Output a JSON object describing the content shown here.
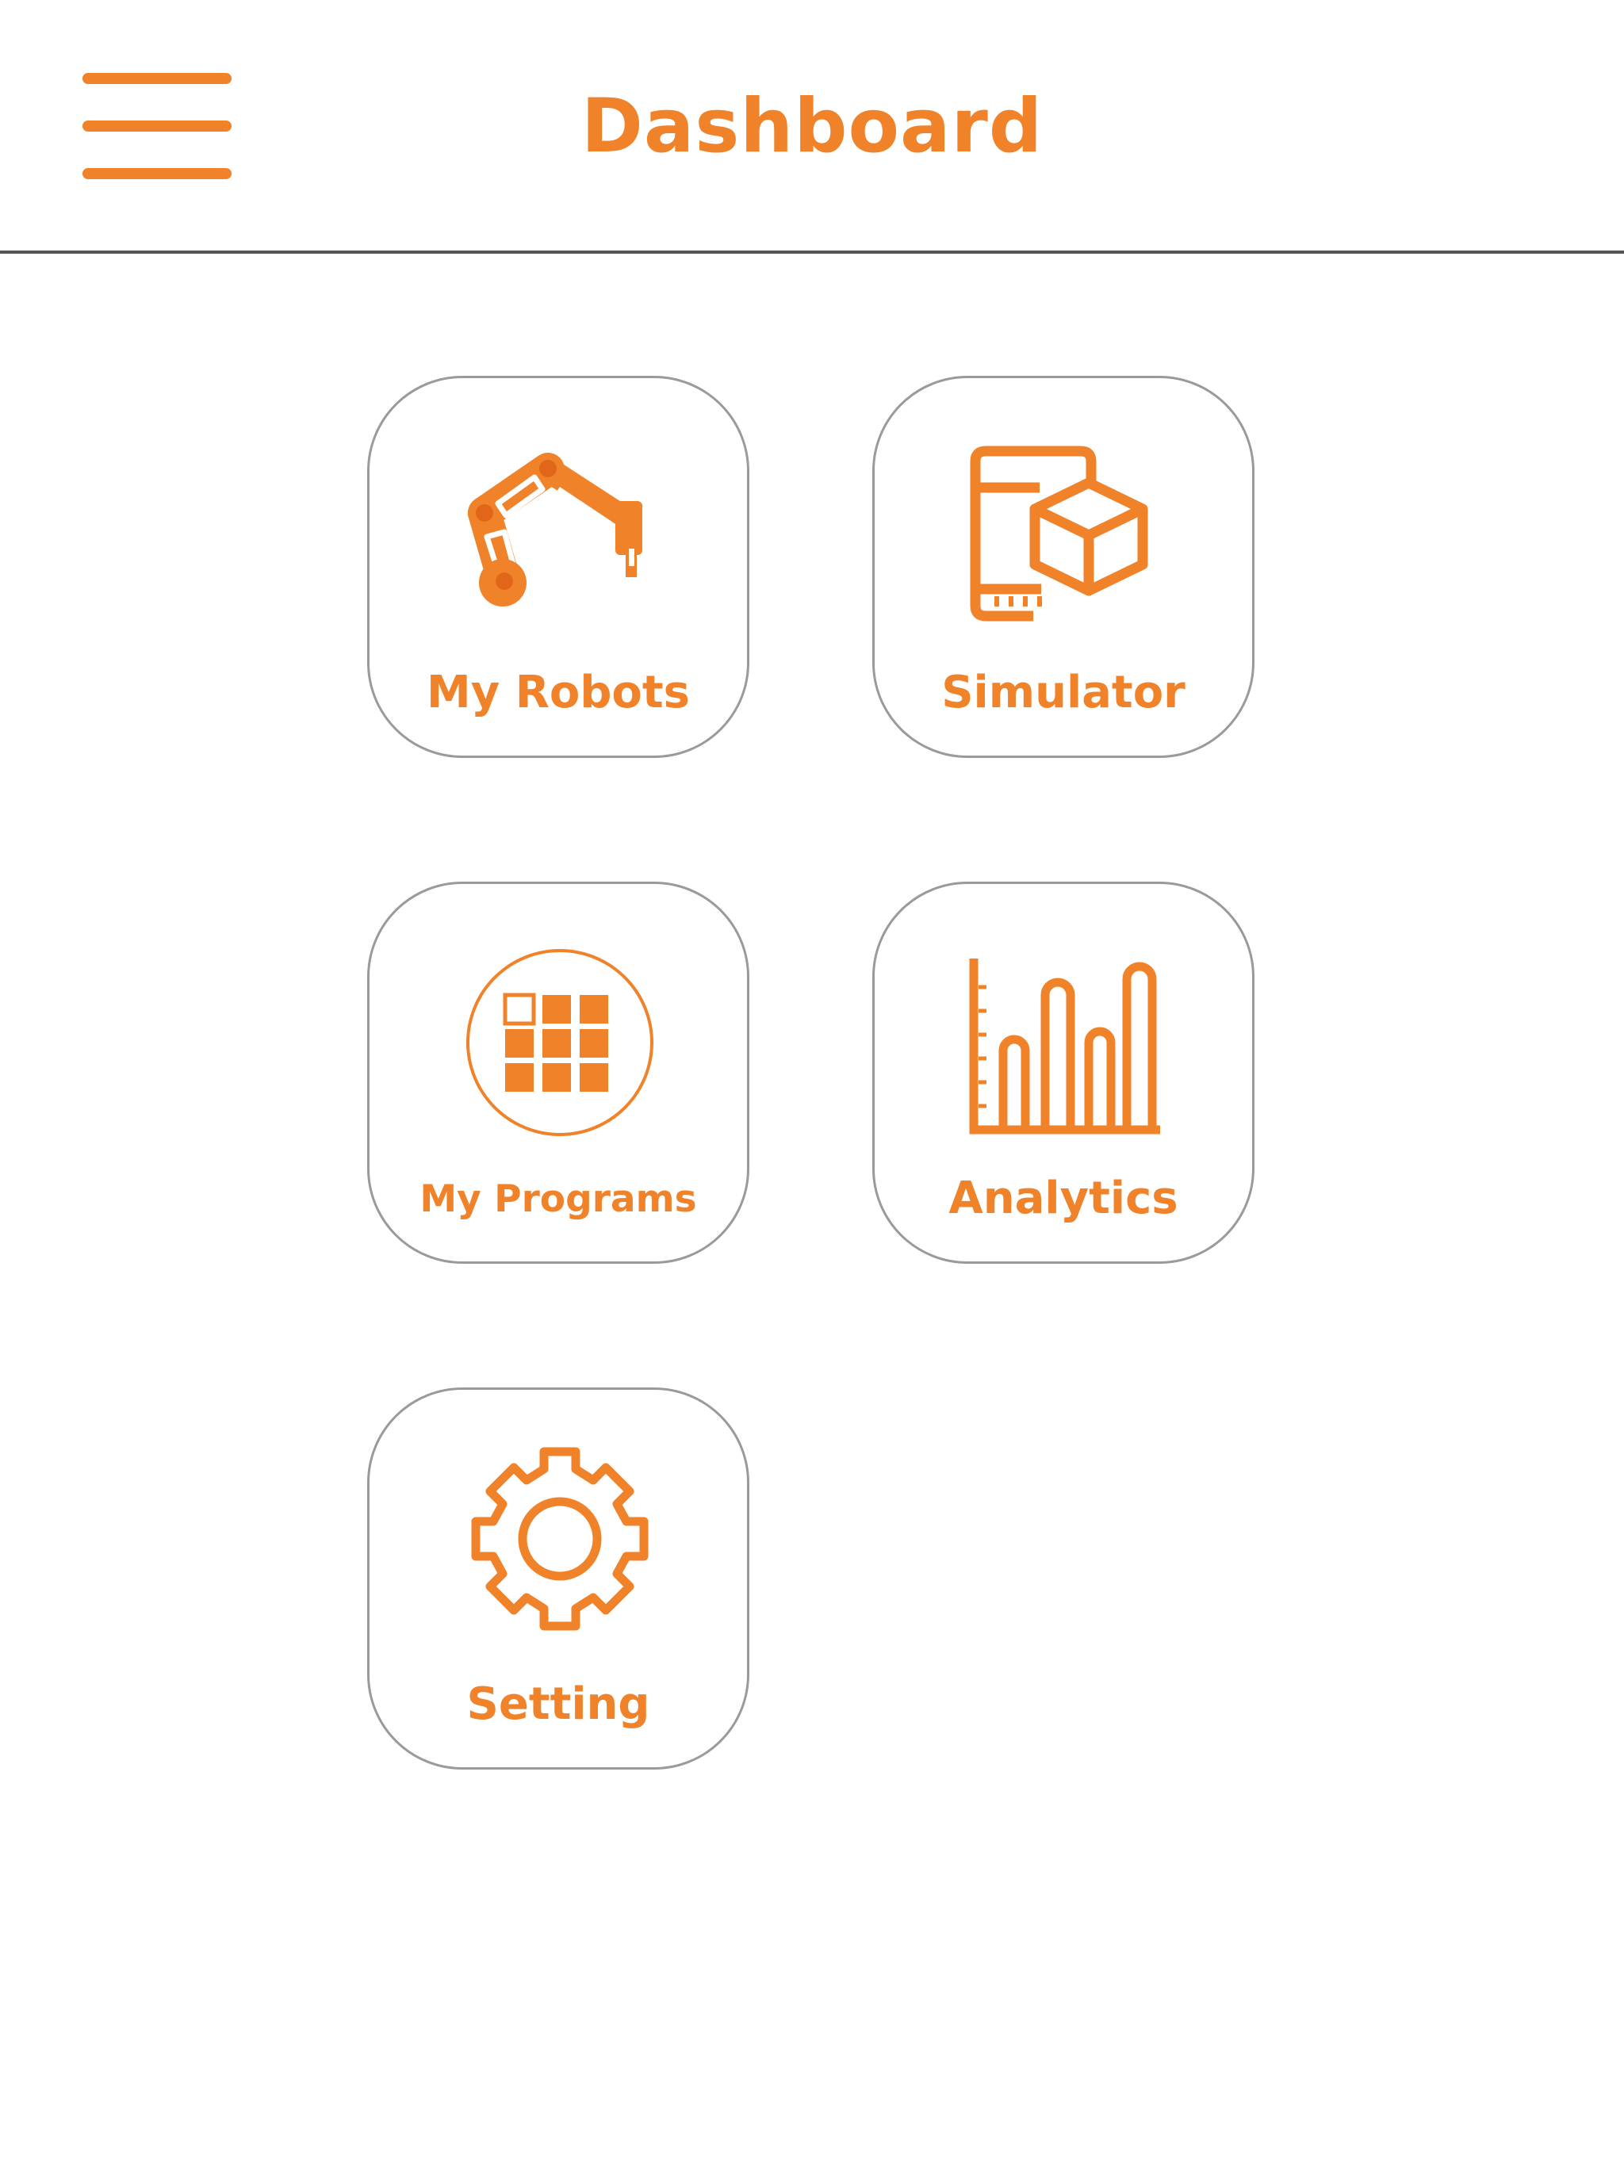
{
  "header": {
    "title": "Dashboard",
    "menu_icon": "hamburger-menu-icon"
  },
  "tiles": [
    {
      "label": "My Robots",
      "icon": "robot-arm-icon"
    },
    {
      "label": "Simulator",
      "icon": "phone-cube-icon"
    },
    {
      "label": "My Programs",
      "icon": "program-grid-icon"
    },
    {
      "label": "Analytics",
      "icon": "bar-chart-icon"
    },
    {
      "label": "Setting",
      "icon": "gear-icon"
    }
  ],
  "colors": {
    "accent": "#f0822a",
    "tile_border": "#9a9a9a",
    "header_divider": "#555555",
    "background": "#ffffff"
  }
}
